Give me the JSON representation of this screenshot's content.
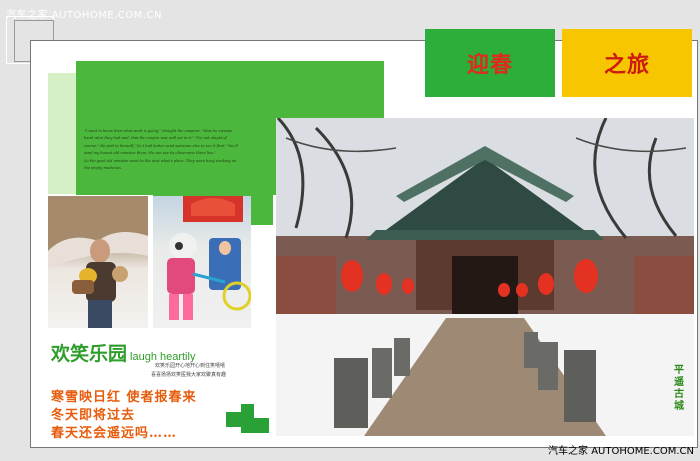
{
  "watermark_top": "汽车之家  AUTOHOME.COM.CN",
  "watermark_bottom": "汽车之家  AUTOHOME.COM.CN",
  "banner": {
    "left": "迎春",
    "right": "之旅"
  },
  "poem": [
    "\"I want to know then what work is going,\" thought the emperor. \"How he sweeps",
    "hand what they had said, that the empire was well set in it.\" \"I'm not stupid of",
    "course.\" He said to himself, \"So I had better send someone else to see it first.\" You'll",
    "send my honest old minister there. He can see its cleverness there lies.\"",
    "So the good old minister went to the next what's place. They were busy working on",
    "the empty machines."
  ],
  "happy": {
    "cn": "欢笑乐园",
    "en": "laugh heartily",
    "sub1": "欢笑乐园开心地开心到住笑嘻嘻",
    "sub2": "喜喜扬扬欢笑医我大家欢聚真有趣"
  },
  "verses": [
    "寒雪映日红  使者报春来",
    "冬天即将过去",
    "春天还会遥远吗……"
  ],
  "side_label": "平遥古城",
  "colors": {
    "green": "#4cb73d",
    "yellow": "#f7c600",
    "red_text": "#e02a1a",
    "orange_text": "#e75c0c"
  }
}
